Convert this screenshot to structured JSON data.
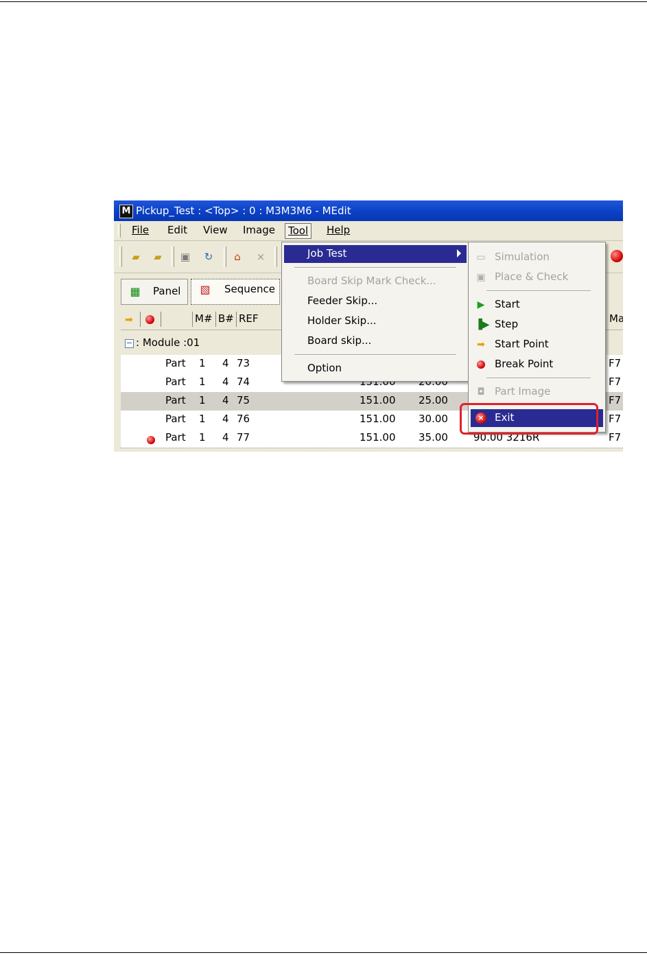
{
  "window": {
    "app_icon": "M",
    "title": "Pickup_Test : <Top> : 0 : M3M3M6 - MEdit"
  },
  "menubar": {
    "items": [
      {
        "label": "File"
      },
      {
        "label": "Edit"
      },
      {
        "label": "View"
      },
      {
        "label": "Image"
      },
      {
        "label": "Tool",
        "state": "open"
      },
      {
        "label": "Help"
      }
    ]
  },
  "toolbar": {
    "icons": [
      "open-folder-icon",
      "folder-icon",
      "save-icon",
      "refresh-icon",
      "home-icon",
      "close-icon",
      "red-ball-icon"
    ]
  },
  "tabs": [
    {
      "label": "Panel",
      "icon": "panel-grid-icon"
    },
    {
      "label": "Sequence",
      "icon": "sequence-icon",
      "active": true
    }
  ],
  "grid": {
    "headers": [
      "M#",
      "B#",
      "REF",
      "Ma"
    ],
    "module_label": ": Module :01",
    "rows": [
      {
        "type": "Part",
        "m": "1",
        "b": "4",
        "ref": "73",
        "x": "",
        "y": "",
        "extra": "",
        "ma": "F7",
        "selected": false,
        "breakpoint": false
      },
      {
        "type": "Part",
        "m": "1",
        "b": "4",
        "ref": "74",
        "x": "151.00",
        "y": "20.00",
        "extra": "",
        "ma": "F7",
        "selected": false,
        "breakpoint": false
      },
      {
        "type": "Part",
        "m": "1",
        "b": "4",
        "ref": "75",
        "x": "151.00",
        "y": "25.00",
        "extra": "",
        "ma": "F7",
        "selected": true,
        "breakpoint": false
      },
      {
        "type": "Part",
        "m": "1",
        "b": "4",
        "ref": "76",
        "x": "151.00",
        "y": "30.00",
        "extra": "",
        "ma": "F7",
        "selected": false,
        "breakpoint": false
      },
      {
        "type": "Part",
        "m": "1",
        "b": "4",
        "ref": "77",
        "x": "151.00",
        "y": "35.00",
        "extra": "90.00 3216R",
        "ma": "F7",
        "selected": false,
        "breakpoint": true
      }
    ]
  },
  "tool_menu": {
    "items": [
      {
        "label": "Job Test",
        "highlighted": true,
        "has_submenu": true
      },
      {
        "label": "Board Skip Mark Check...",
        "disabled": true
      },
      {
        "label": "Feeder Skip..."
      },
      {
        "label": "Holder Skip..."
      },
      {
        "label": "Board skip..."
      },
      {
        "label": "Option"
      }
    ]
  },
  "job_test_submenu": {
    "items": [
      {
        "label": "Simulation",
        "disabled": true,
        "icon": "simulation-icon"
      },
      {
        "label": "Place & Check",
        "disabled": true,
        "icon": "place-check-icon"
      },
      {
        "label": "Start",
        "icon": "start-icon"
      },
      {
        "label": "Step",
        "icon": "step-icon"
      },
      {
        "label": "Start Point",
        "icon": "start-point-icon"
      },
      {
        "label": "Break Point",
        "icon": "break-point-icon"
      },
      {
        "label": "Part Image",
        "disabled": true,
        "icon": "part-image-icon"
      },
      {
        "label": "Exit",
        "highlighted": true,
        "icon": "exit-icon"
      }
    ]
  },
  "annotation": {
    "color": "#e0202c"
  }
}
